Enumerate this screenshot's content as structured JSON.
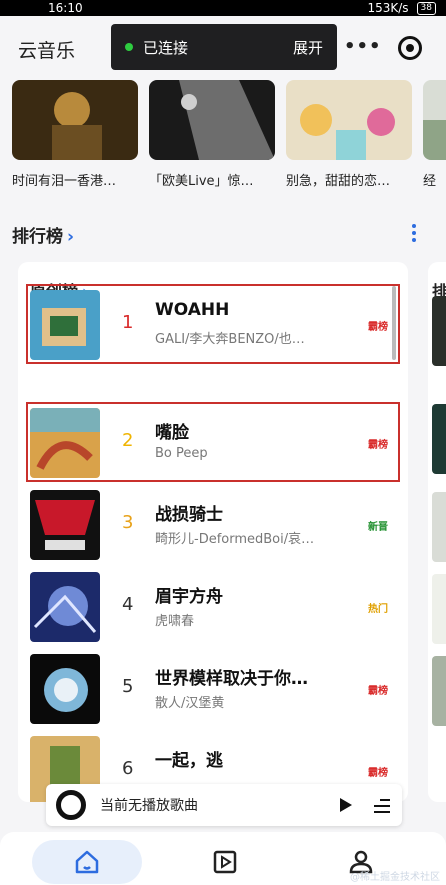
{
  "status_bar": {
    "time": "16:10",
    "network_speed": "153K/s",
    "battery": "38"
  },
  "header": {
    "app_title": "云音乐",
    "connection_status": "已连接",
    "expand_label": "展开",
    "more_icon": "more-dots-icon",
    "target_icon": "target-icon"
  },
  "playlists": [
    {
      "title": "时间有泪一香港…",
      "cover_colors": [
        "#3a2a12",
        "#b88a3c"
      ]
    },
    {
      "title": "「欧美Live」惊…",
      "cover_colors": [
        "#1a1a1a",
        "#cfcfcf"
      ]
    },
    {
      "title": "别急，甜甜的恋…",
      "cover_colors": [
        "#e9dfc6",
        "#e06a9a"
      ]
    },
    {
      "title": "经",
      "cover_colors": [
        "#d9ddd5",
        "#8fa487"
      ]
    }
  ],
  "ranking_section": {
    "heading": "排行榜",
    "card_title": "原创榜",
    "next_card_initial": "排"
  },
  "songs": [
    {
      "rank": "1",
      "name": "WOAHH",
      "artist": "GALI/李大奔BENZO/也…",
      "tag": "霸榜",
      "rank_color": "#d92b2b",
      "tag_color": "#d92b2b",
      "highlighted": true,
      "cover_colors": [
        "#4aa0c8",
        "#e0c08a"
      ]
    },
    {
      "rank": "2",
      "name": "嘴脸",
      "artist": "Bo Peep",
      "tag": "霸榜",
      "rank_color": "#f0b400",
      "tag_color": "#d92b2b",
      "highlighted": true,
      "cover_colors": [
        "#d9a24a",
        "#7ab0b8"
      ]
    },
    {
      "rank": "3",
      "name": "战损骑士",
      "artist": "畸形儿-DeformedBoi/哀…",
      "tag": "新晋",
      "rank_color": "#e8a21a",
      "tag_color": "#1f8f2d",
      "highlighted": false,
      "cover_colors": [
        "#111111",
        "#c8182a"
      ]
    },
    {
      "rank": "4",
      "name": "眉宇方舟",
      "artist": "虎啸春",
      "tag": "热门",
      "rank_color": "#333333",
      "tag_color": "#e0a000",
      "highlighted": false,
      "cover_colors": [
        "#1c2a6a",
        "#6f8ad6"
      ]
    },
    {
      "rank": "5",
      "name": "世界模样取决于你…",
      "artist": "散人/汉堡黄",
      "tag": "霸榜",
      "rank_color": "#333333",
      "tag_color": "#d92b2b",
      "highlighted": false,
      "cover_colors": [
        "#0a0a0a",
        "#7fb7d9"
      ]
    },
    {
      "rank": "6",
      "name": "一起，逃",
      "artist": "",
      "tag": "霸榜",
      "rank_color": "#333333",
      "tag_color": "#d92b2b",
      "highlighted": false,
      "cover_colors": [
        "#d9b26a",
        "#6b8a3a"
      ]
    }
  ],
  "mini_player": {
    "text": "当前无播放歌曲",
    "disc_icon": "disc-icon",
    "play_icon": "play-icon",
    "playlist_icon": "playlist-icon"
  },
  "tabbar": {
    "items": [
      {
        "name": "home",
        "icon": "home-icon",
        "active": true
      },
      {
        "name": "player",
        "icon": "play-square-icon",
        "active": false
      },
      {
        "name": "profile",
        "icon": "user-icon",
        "active": false
      }
    ]
  },
  "watermark": "@稀土掘金技术社区"
}
